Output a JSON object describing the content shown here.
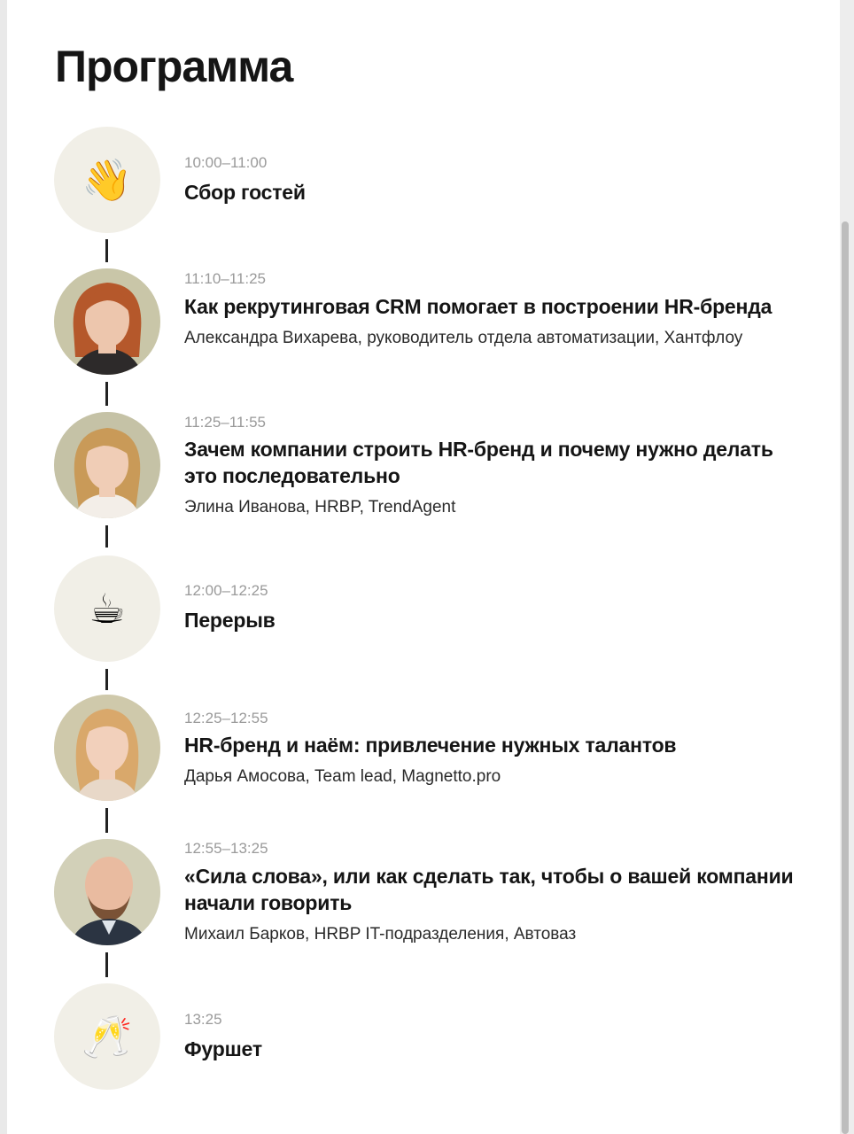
{
  "program": {
    "title": "Программа",
    "items": [
      {
        "time": "10:00–11:00",
        "title": "Сбор гостей",
        "speaker": "",
        "icon": "waving-hand-icon",
        "emoji": "👋"
      },
      {
        "time": "11:10–11:25",
        "title": "Как рекрутинговая CRM помогает в построении HR-бренда",
        "speaker": "Александра Вихарева, руководитель отдела автоматизации, Хантфлоу",
        "icon": "speaker-photo"
      },
      {
        "time": "11:25–11:55",
        "title": "Зачем компании строить HR-бренд и почему нужно делать это последовательно",
        "speaker": "Элина Иванова, HRBP, TrendAgent",
        "icon": "speaker-photo"
      },
      {
        "time": "12:00–12:25",
        "title": "Перерыв",
        "speaker": "",
        "icon": "coffee-cup-icon",
        "emoji": "☕"
      },
      {
        "time": "12:25–12:55",
        "title": "HR-бренд и наём: привлечение нужных талантов",
        "speaker": "Дарья Амосова, Team lead, Magnetto.pro",
        "icon": "speaker-photo"
      },
      {
        "time": "12:55–13:25",
        "title": "«Сила слова», или как сделать так, чтобы о вашей компании начали говорить",
        "speaker": "Михаил Барков, HRBP IT-подразделения, Автоваз",
        "icon": "speaker-photo"
      },
      {
        "time": "13:25",
        "title": "Фуршет",
        "speaker": "",
        "icon": "champagne-glasses-icon",
        "emoji": "🥂"
      }
    ]
  },
  "colors": {
    "avatar_bg": "#f1efe7",
    "text": "#151515",
    "muted": "#9a9a9a"
  }
}
